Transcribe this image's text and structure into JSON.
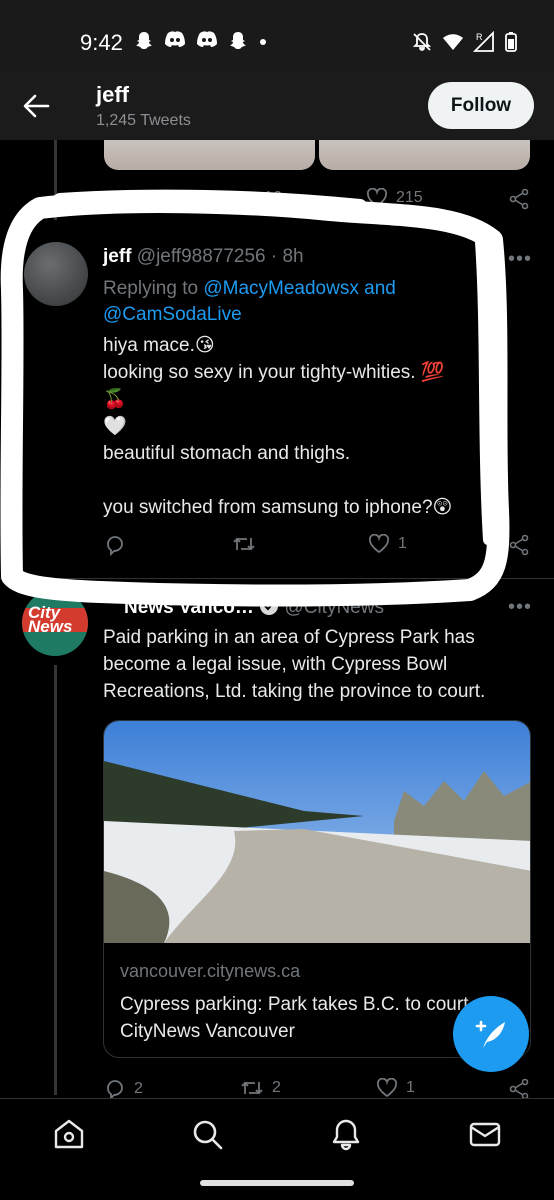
{
  "status_bar": {
    "time": "9:42",
    "icons": [
      "snapchat-icon",
      "discord-icon",
      "discord-icon",
      "snapchat-icon",
      "dot-icon",
      "mute-icon",
      "wifi-icon",
      "signal-icon",
      "battery-icon"
    ],
    "signal_label": "R"
  },
  "header": {
    "name": "jeff",
    "tweet_count": "1,245 Tweets",
    "follow_label": "Follow"
  },
  "prev_tweet": {
    "retweets": "16",
    "likes": "215"
  },
  "tweet1": {
    "name": "jeff",
    "handle_time": "@jeff98877256 · 8h",
    "replying_prefix": "Replying to ",
    "mention1": "@MacyMeadowsx",
    "and_label": " and",
    "mention2": "@CamSodaLive",
    "lines": [
      "hiya mace.😘",
      "looking so sexy in your tighty-whities. 💯",
      "🍒",
      "🤍",
      "beautiful stomach and thighs.",
      "",
      "you switched from samsung to iphone?😲"
    ],
    "likes": "1"
  },
  "tweet2": {
    "name_partial": "News Vanco…",
    "avatar_text_line1": "City",
    "avatar_text_line2": "News",
    "handle_partial": "@CityNews",
    "body": "Paid parking in an area of Cypress Park has become a legal issue, with Cypress Bowl Recreations, Ltd. taking the province to court.",
    "card_domain": "vancouver.citynews.ca",
    "card_title": "Cypress parking: Park takes B.C. to court",
    "card_source": "CityNews Vancouver",
    "replies": "2",
    "retweets": "2",
    "likes": "1"
  },
  "colors": {
    "accent": "#1d9bf0",
    "background": "#000000",
    "muted": "#71767b"
  }
}
